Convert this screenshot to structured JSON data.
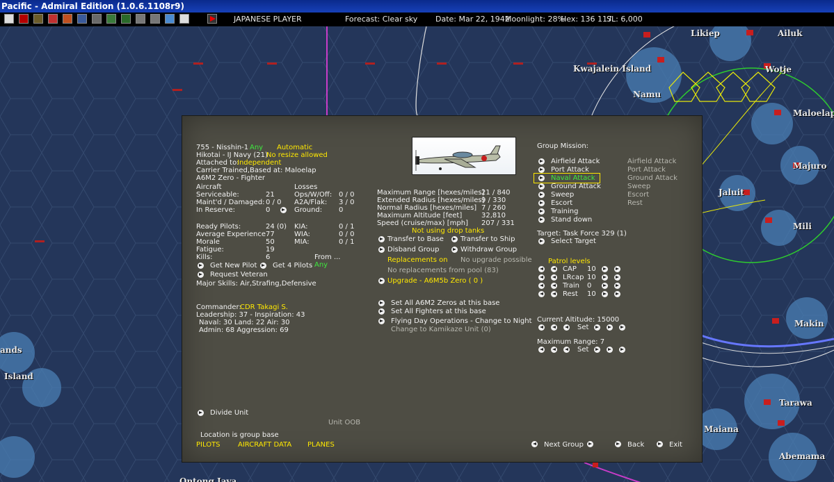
{
  "window": {
    "title": "Pacific - Admiral Edition (1.0.6.1108r9)"
  },
  "toolbar": {
    "player": "JAPANESE PLAYER",
    "forecast": "Forecast: Clear sky",
    "date": "Date: Mar 22, 1942",
    "moonlight": "Moonlight: 28%",
    "hex": "Hex: 136 117",
    "sl": "SL: 6,000",
    "icons": [
      "info-icon",
      "rising-sun-icon",
      "airfield-icon",
      "cross-icon",
      "flag-icon",
      "ship-icon",
      "aircraft-icon",
      "factory-icon",
      "unit-icon",
      "target-icon",
      "ops-icon",
      "database-icon",
      "globe-icon",
      "end-turn-icon"
    ]
  },
  "map": {
    "labels": [
      "Likiep",
      "Ailuk",
      "Kwajalein Island",
      "Wotje",
      "Namu",
      "Maloelap",
      "Majuro",
      "Jaluit",
      "Mili",
      "Makin",
      "Tarawa",
      "Maiana",
      "Abemama",
      "ands",
      "Island",
      "Ontong Java"
    ]
  },
  "unit": {
    "name": "755 - Nisshin-1",
    "name_any": "Any",
    "mode": "Automatic",
    "type": "Hikotai - IJ Navy (21)",
    "resize": "No resize allowed",
    "attached_label": "Attached to:",
    "attached_value": "Independent",
    "carrier": "Carrier Trained,Based at: Maloelap",
    "aircraft_type": "A6M2 Zero - Fighter"
  },
  "aircraft": {
    "header": "Aircraft",
    "rows": [
      {
        "label": "Serviceable:",
        "value": "21"
      },
      {
        "label": "Maint'd / Damaged:",
        "value": "0 / 0"
      },
      {
        "label": "In Reserve:",
        "value": "0"
      }
    ]
  },
  "losses": {
    "header": "Losses",
    "rows": [
      {
        "label": "Ops/W/Off:",
        "value": "0 / 0"
      },
      {
        "label": "A2A/Flak:",
        "value": "3 / 0"
      },
      {
        "label": "Ground:",
        "value": "0"
      }
    ]
  },
  "pilots": {
    "rows": [
      {
        "label": "Ready Pilots:",
        "value": "24 (0)"
      },
      {
        "label": "Average Experience",
        "value": "77"
      },
      {
        "label": "Morale",
        "value": "50"
      },
      {
        "label": "Fatigue:",
        "value": "19"
      },
      {
        "label": "Kills:",
        "value": "6"
      }
    ],
    "casualties": [
      {
        "label": "KIA:",
        "value": "0 / 1"
      },
      {
        "label": "WIA:",
        "value": "0 / 0"
      },
      {
        "label": "MIA:",
        "value": "0 / 1"
      }
    ],
    "from_label": "From ...",
    "from_value": "Any",
    "get_new_pilot": "Get New Pilot",
    "get_4_pilots": "Get 4 Pilots",
    "request_veteran": "Request Veteran",
    "major_skills": "Major Skills: Air,Strafing,Defensive"
  },
  "commander": {
    "label": "Commander:",
    "name": "CDR Takagi S.",
    "leadership": "Leadership: 37 - Inspiration: 43",
    "ratings": "Naval: 30  Land: 22  Air: 30",
    "admin": "Admin: 68  Aggression: 69"
  },
  "specs": [
    {
      "label": "Maximum Range [hexes/miles]",
      "value": "21 / 840"
    },
    {
      "label": "Extended Radius [hexes/miles]",
      "value": "9 / 330"
    },
    {
      "label": "Normal Radius [hexes/miles]",
      "value": "7 / 260"
    },
    {
      "label": "Maximum Altitude [feet]",
      "value": "32,810"
    },
    {
      "label": "Speed (cruise/max) [mph]",
      "value": "207 / 331"
    }
  ],
  "actions": {
    "drop_tanks": "Not using drop tanks",
    "transfer_base": "Transfer to Base",
    "transfer_ship": "Transfer to Ship",
    "disband": "Disband Group",
    "withdraw": "Withdraw Group",
    "replacements_on": "Replacements on",
    "no_upgrade": "No upgrade possible",
    "no_replacements": "No replacements from pool (83)",
    "upgrade": "Upgrade - A6M5b Zero  ( 0 )",
    "set_all_a6m2": "Set All A6M2 Zeros at this base",
    "set_all_fighters": "Set All Fighters at this base",
    "flying_day": "Flying Day Operations - Change to Night",
    "kamikaze": "Change to Kamikaze Unit (0)"
  },
  "mission": {
    "header": "Group Mission:",
    "options": [
      "Airfield Attack",
      "Port Attack",
      "Naval Attack",
      "Ground Attack",
      "Sweep",
      "Escort",
      "Training",
      "Stand down"
    ],
    "selected_index": 2,
    "secondary": [
      "Airfield Attack",
      "Port Attack",
      "Ground Attack",
      "Sweep",
      "Escort",
      "Rest"
    ],
    "target": "Target: Task Force 329  (1)",
    "select_target": "Select Target"
  },
  "patrol": {
    "header": "Patrol levels",
    "rows": [
      {
        "label": "CAP",
        "value": "10"
      },
      {
        "label": "LRcap",
        "value": "10"
      },
      {
        "label": "Train",
        "value": "0"
      },
      {
        "label": "Rest",
        "value": "10"
      }
    ]
  },
  "altitude": {
    "current": "Current Altitude: 15000",
    "max_range": "Maximum Range: 7",
    "set_label": "Set"
  },
  "bottom": {
    "divide_unit": "Divide Unit",
    "unit_oob": "Unit OOB",
    "location": "Location is group base",
    "pilots_link": "PILOTS",
    "aircraft_data_link": "AIRCRAFT DATA",
    "planes_link": "PLANES",
    "next_group": "Next Group",
    "back": "Back",
    "exit": "Exit"
  },
  "colors": {
    "panel": "#4e4d44",
    "ocean": "#24365a",
    "accent_yellow": "#ffe800",
    "accent_green": "#3fe83f",
    "titlebar": "#0a2a8c"
  }
}
